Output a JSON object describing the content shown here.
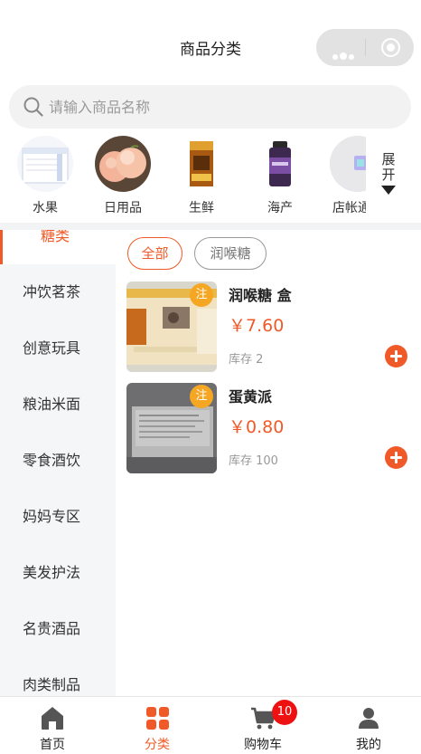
{
  "header": {
    "title": "商品分类"
  },
  "search": {
    "placeholder": "请输入商品名称"
  },
  "top_categories": [
    {
      "label": "水果"
    },
    {
      "label": "日用品"
    },
    {
      "label": "生鲜"
    },
    {
      "label": "海产"
    },
    {
      "label": "店帐通分"
    }
  ],
  "expand": {
    "line1": "展",
    "line2": "开"
  },
  "side_menu": [
    {
      "label": "糖类",
      "active": true
    },
    {
      "label": "冲饮茗茶"
    },
    {
      "label": "创意玩具"
    },
    {
      "label": "粮油米面"
    },
    {
      "label": "零食酒饮"
    },
    {
      "label": "妈妈专区"
    },
    {
      "label": "美发护法"
    },
    {
      "label": "名贵酒品"
    },
    {
      "label": "肉类制品"
    }
  ],
  "filters": [
    {
      "label": "全部",
      "active": true
    },
    {
      "label": "润喉糖"
    }
  ],
  "products": [
    {
      "tag": "注",
      "name": "润喉糖 盒",
      "price": "￥7.60",
      "stock": "库存 2"
    },
    {
      "tag": "注",
      "name": "蛋黄派",
      "price": "￥0.80",
      "stock": "库存 100"
    }
  ],
  "tabbar": {
    "home": "首页",
    "category": "分类",
    "cart": "购物车",
    "cart_badge": "10",
    "mine": "我的"
  },
  "colors": {
    "accent": "#f05a28",
    "badge": "#ee1111",
    "tag": "#f5a623"
  },
  "icons": [
    "search-icon",
    "more-icon",
    "close-target-icon",
    "expand-arrow-icon",
    "plus-icon",
    "home-icon",
    "category-grid-icon",
    "cart-icon",
    "user-icon"
  ]
}
